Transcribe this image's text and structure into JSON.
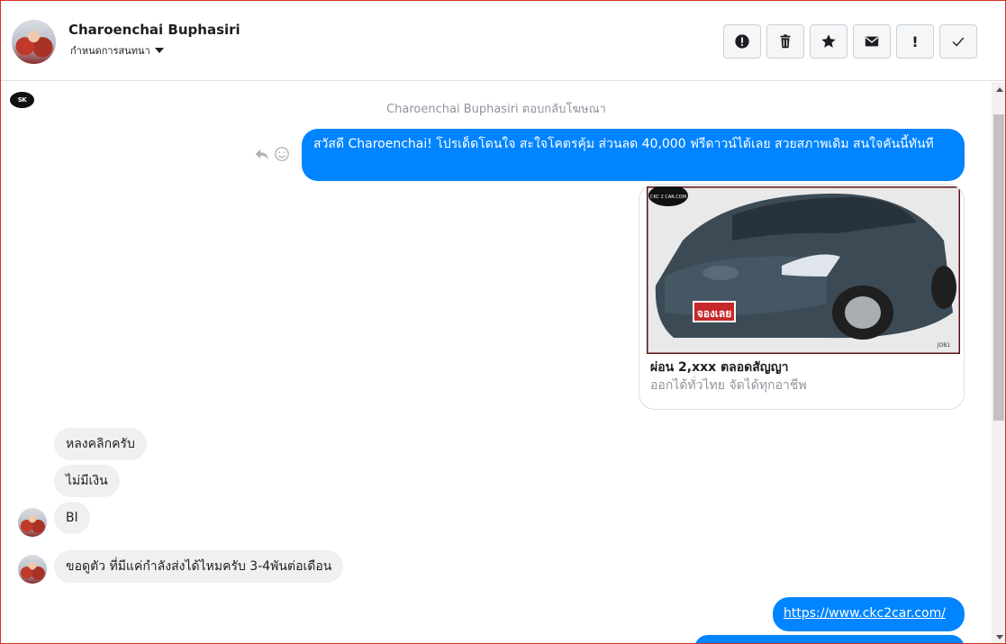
{
  "header": {
    "contact_name": "Charoenchai Buphasiri",
    "assign_label": "กำหนดการสนทนา",
    "actions": [
      {
        "name": "report",
        "icon": "alert-circle-icon"
      },
      {
        "name": "delete",
        "icon": "trash-icon"
      },
      {
        "name": "star",
        "icon": "star-icon"
      },
      {
        "name": "mark-unread",
        "icon": "envelope-icon"
      },
      {
        "name": "mark-spam",
        "icon": "exclamation-icon",
        "glyph": "!"
      },
      {
        "name": "mark-done",
        "icon": "check-icon"
      }
    ]
  },
  "page_logo": {
    "text": "SK"
  },
  "conversation": {
    "system_note": "Charoenchai Buphasiri ตอบกลับโฆษณา",
    "outgoing_greeting": "สวัสดี Charoenchai! โปรเด็ดโดนใจ สะใจโคตรคุ้ม ส่วนลด 40,000 ฟรีดาวน์ได้เลย สวยสภาพเดิม สนใจคันนี้ทันที",
    "card": {
      "title": "ผ่อน 2,xxx ตลอดสัญญา",
      "subtitle": "ออกได้ทั่วไทย จัดได้ทุกอาชีพ",
      "badge_text": "จองเลย",
      "brand_text": "CKC 2 CAR.COM",
      "plate_text": "JOB1"
    },
    "incoming": [
      "หลงคลิกครับ",
      "ไม่มีเงิน",
      "Bl",
      "ขอดูตัว ที่มีแค่กำลังส่งได้ไหมครับ 3-4พันต่อเดือน"
    ],
    "outgoing_link": "https://www.ckc2car.com/"
  },
  "colors": {
    "outgoing_bubble": "#0084ff",
    "incoming_bubble": "#f1f0f0",
    "muted_text": "#90949c",
    "frame_border": "#d93025"
  }
}
